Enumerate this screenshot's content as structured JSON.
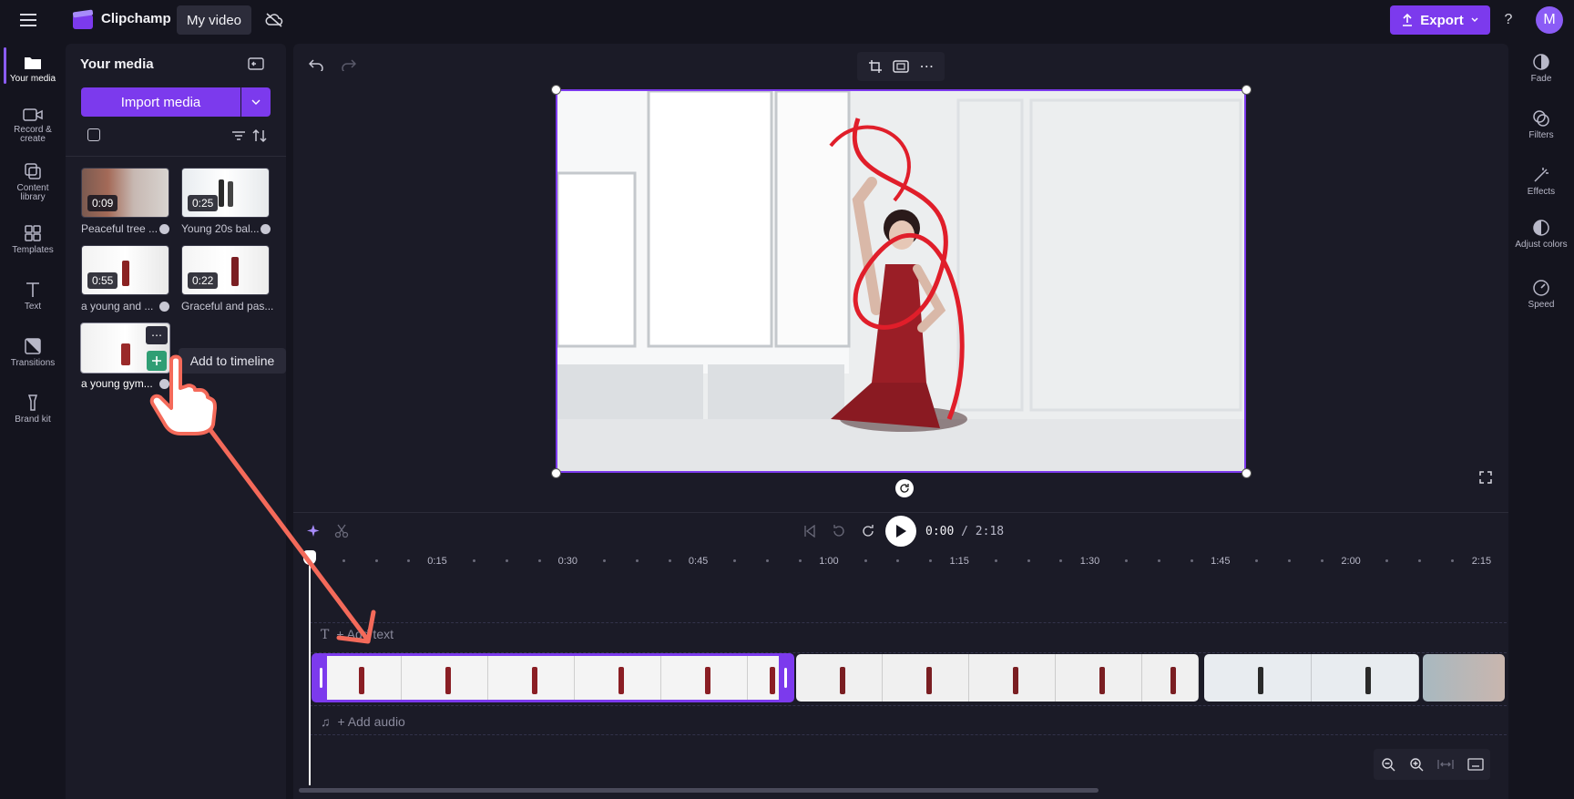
{
  "app": {
    "name": "Clipchamp",
    "project_title": "My video",
    "export_label": "Export",
    "help_label": "?",
    "avatar_initial": "M",
    "accent": "#7c3aed"
  },
  "left_nav": [
    {
      "label": "Your media",
      "icon": "folder-icon",
      "active": true
    },
    {
      "label": "Record & create",
      "icon": "camera-icon"
    },
    {
      "label": "Content library",
      "icon": "library-icon"
    },
    {
      "label": "Templates",
      "icon": "templates-icon"
    },
    {
      "label": "Text",
      "icon": "text-icon"
    },
    {
      "label": "Transitions",
      "icon": "transitions-icon"
    },
    {
      "label": "Brand kit",
      "icon": "brand-kit-icon"
    }
  ],
  "media_panel": {
    "title": "Your media",
    "import_label": "Import media",
    "items": [
      {
        "duration": "0:09",
        "label": "Peaceful tree ..."
      },
      {
        "duration": "0:25",
        "label": "Young 20s bal..."
      },
      {
        "duration": "0:55",
        "label": "a young and ..."
      },
      {
        "duration": "0:22",
        "label": "Graceful and pas..."
      },
      {
        "duration": "",
        "label": "a young gym..."
      }
    ],
    "tooltip": "Add to timeline"
  },
  "playback": {
    "current": "0:00",
    "total": "/ 2:18"
  },
  "ruler": [
    "0:15",
    "0:30",
    "0:45",
    "1:00",
    "1:15",
    "1:30",
    "1:45",
    "2:00",
    "2:15"
  ],
  "timeline": {
    "add_text": "+ Add text",
    "add_audio": "+ Add audio"
  },
  "right_panel": [
    {
      "label": "Fade",
      "icon": "fade-icon"
    },
    {
      "label": "Filters",
      "icon": "filters-icon"
    },
    {
      "label": "Effects",
      "icon": "effects-icon"
    },
    {
      "label": "Adjust colors",
      "icon": "adjust-colors-icon"
    },
    {
      "label": "Speed",
      "icon": "speed-icon"
    }
  ]
}
